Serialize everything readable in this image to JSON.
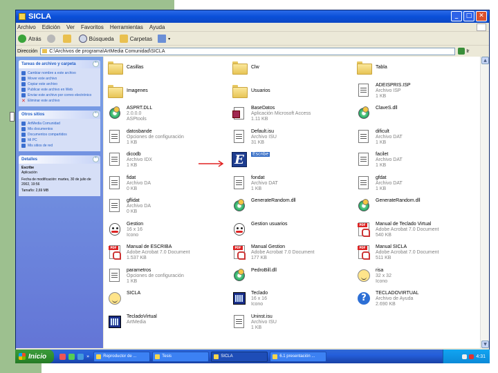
{
  "window": {
    "title": "SICLA",
    "address_label": "Dirección",
    "address_path": "C:\\Archivos de programa\\ArtMedia Comunidad\\SICLA",
    "go_label": "Ir"
  },
  "menubar": [
    "Archivo",
    "Edición",
    "Ver",
    "Favoritos",
    "Herramientas",
    "Ayuda"
  ],
  "toolbar": {
    "back_label": "Atrás",
    "search_label": "Búsqueda",
    "folders_label": "Carpetas"
  },
  "tasks_panel": {
    "title": "Tareas de archivo y carpeta",
    "items": [
      {
        "label": "Cambiar nombre a este archivo",
        "icon": "rename-icon"
      },
      {
        "label": "Mover este archivo",
        "icon": "move-icon"
      },
      {
        "label": "Copiar este archivo",
        "icon": "copy-icon"
      },
      {
        "label": "Publicar este archivo en Web",
        "icon": "publish-web-icon"
      },
      {
        "label": "Enviar este archivo por correo electrónico",
        "icon": "email-icon"
      },
      {
        "label": "Eliminar este archivo",
        "icon": "delete-icon"
      }
    ]
  },
  "places_panel": {
    "title": "Otros sitios",
    "items": [
      {
        "label": "ArtMedia Comunidad"
      },
      {
        "label": "Mis documentos"
      },
      {
        "label": "Documentos compartidos"
      },
      {
        "label": "Mi PC"
      },
      {
        "label": "Mis sitios de red"
      }
    ]
  },
  "details_panel": {
    "title": "Detalles",
    "name": "Escribe",
    "type": "Aplicación",
    "modified": "Fecha de modificación: martes, 30 de julio de 2002, 19:56",
    "size": "Tamaño: 2,69 MB"
  },
  "files": [
    {
      "name": "Casillas",
      "lines": [],
      "icon": "folder"
    },
    {
      "name": "Clw",
      "lines": [],
      "icon": "folder"
    },
    {
      "name": "Tabla",
      "lines": [],
      "icon": "folder"
    },
    {
      "name": "Imagenes",
      "lines": [],
      "icon": "folder"
    },
    {
      "name": "Usuarios",
      "lines": [],
      "icon": "folder"
    },
    {
      "name": "ADEISPRIS.ISP",
      "lines": [
        "Archivo ISP",
        "1 KB"
      ],
      "icon": "doc"
    },
    {
      "name": "ASPRT.DLL",
      "lines": [
        "2.0.0.0",
        "ASPtools"
      ],
      "icon": "gear"
    },
    {
      "name": "BaseDatos",
      "lines": [
        "Aplicación Microsoft Access",
        "1.11 KB"
      ],
      "icon": "mdb"
    },
    {
      "name": "ClaveS.dll",
      "lines": [],
      "icon": "gear"
    },
    {
      "name": "datosbande",
      "lines": [
        "Opciones de configuración",
        "1 KB"
      ],
      "icon": "doc"
    },
    {
      "name": "Default.isu",
      "lines": [
        "Archivo ISU",
        "31 KB"
      ],
      "icon": "doc"
    },
    {
      "name": "dificult",
      "lines": [
        "Archivo DAT",
        "1 KB"
      ],
      "icon": "doc"
    },
    {
      "name": "dicodb",
      "lines": [
        "Archivo IDX",
        "1 KB"
      ],
      "icon": "doc"
    },
    {
      "name": "Escribe",
      "lines": [],
      "icon": "bigE",
      "selected": true
    },
    {
      "name": "facilet",
      "lines": [
        "Archivo DAT",
        "1 KB"
      ],
      "icon": "doc"
    },
    {
      "name": "fidat",
      "lines": [
        "Archivo DA",
        "0 KB"
      ],
      "icon": "doc"
    },
    {
      "name": "fondat",
      "lines": [
        "Archivo DAT",
        "1 KB"
      ],
      "icon": "doc"
    },
    {
      "name": "gfdat",
      "lines": [
        "Archivo DAT",
        "1 KB"
      ],
      "icon": "doc"
    },
    {
      "name": "gflidat",
      "lines": [
        "Archivo DA",
        "0 KB"
      ],
      "icon": "doc"
    },
    {
      "name": "GenerateRandom.dll",
      "lines": [],
      "icon": "gear"
    },
    {
      "name": "GenerateRandom.dll",
      "lines": [],
      "icon": "gear"
    },
    {
      "name": "Gestion",
      "lines": [
        "16 x 16",
        "Icono"
      ],
      "icon": "person"
    },
    {
      "name": "Gestion usuarios",
      "lines": [],
      "icon": "person"
    },
    {
      "name": "Manual de Teclado Virtual",
      "lines": [
        "Adobe Acrobat 7.0 Document",
        "540 KB"
      ],
      "icon": "pdf"
    },
    {
      "name": "Manual de ESCRIBA",
      "lines": [
        "Adobe Acrobat 7.0 Document",
        "1.537 KB"
      ],
      "icon": "pdf"
    },
    {
      "name": "Manual Gestion",
      "lines": [
        "Adobe Acrobat 7.0 Document",
        "177 KB"
      ],
      "icon": "pdf"
    },
    {
      "name": "Manual SICLA",
      "lines": [
        "Adobe Acrobat 7.0 Document",
        "511 KB"
      ],
      "icon": "pdf"
    },
    {
      "name": "parametros",
      "lines": [
        "Opciones de configuración",
        "1 KB"
      ],
      "icon": "doc"
    },
    {
      "name": "PedroBill.dll",
      "lines": [],
      "icon": "gear"
    },
    {
      "name": "risa",
      "lines": [
        "32 x 32",
        "Icono"
      ],
      "icon": "face"
    },
    {
      "name": "SICLA",
      "lines": [],
      "icon": "face"
    },
    {
      "name": "Teclado",
      "lines": [
        "16 x 16",
        "Icono"
      ],
      "icon": "app"
    },
    {
      "name": "TECLADOVIRTUAL",
      "lines": [
        "Archivo de Ayuda",
        "2.690 KB"
      ],
      "icon": "help"
    },
    {
      "name": "TecladoVirtual",
      "lines": [
        "ArtMedia"
      ],
      "icon": "app"
    },
    {
      "name": "Uninst.isu",
      "lines": [
        "Archivo ISU",
        "1 KB"
      ],
      "icon": "doc"
    }
  ],
  "taskbar": {
    "start_label": "Inicio",
    "quick_more": "»",
    "tasks": [
      {
        "label": "Reproductor de ...",
        "active": false
      },
      {
        "label": "Tesis",
        "active": false
      },
      {
        "label": "SICLA",
        "active": true
      },
      {
        "label": "6.1 presentación ...",
        "active": false
      }
    ],
    "clock": "4:31"
  }
}
